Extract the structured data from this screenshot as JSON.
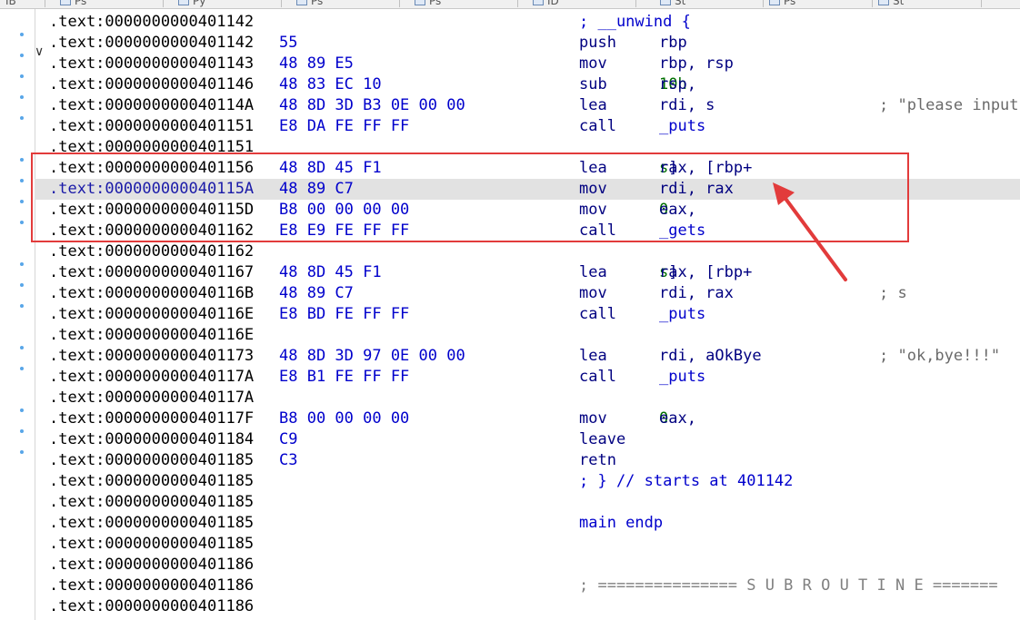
{
  "window": {
    "tabs": [
      "IB",
      "Ps",
      "Py",
      "Ps",
      "Ps",
      "ID",
      "St",
      "Ps",
      "St"
    ]
  },
  "listing": [
    {
      "addr": ".text:0000000000401142",
      "bytes": "",
      "mnem": "; __unwind {",
      "ops": [],
      "cmt": ""
    },
    {
      "addr": ".text:0000000000401142",
      "bytes": "55",
      "mnem": "push",
      "ops": [
        {
          "t": "rbp",
          "c": "reg"
        }
      ],
      "cmt": ""
    },
    {
      "addr": ".text:0000000000401143",
      "bytes": "48 89 E5",
      "mnem": "mov",
      "ops": [
        {
          "t": "rbp, rsp",
          "c": "reg"
        }
      ],
      "cmt": ""
    },
    {
      "addr": ".text:0000000000401146",
      "bytes": "48 83 EC 10",
      "mnem": "sub",
      "ops": [
        {
          "t": "rsp, ",
          "c": "reg"
        },
        {
          "t": "10h",
          "c": "num"
        }
      ],
      "cmt": ""
    },
    {
      "addr": ".text:000000000040114A",
      "bytes": "48 8D 3D B3 0E 00 00",
      "mnem": "lea",
      "ops": [
        {
          "t": "rdi, s",
          "c": "reg"
        }
      ],
      "cmt": "; \"please input"
    },
    {
      "addr": ".text:0000000000401151",
      "bytes": "E8 DA FE FF FF",
      "mnem": "call",
      "ops": [
        {
          "t": "_puts",
          "c": "func"
        }
      ],
      "cmt": ""
    },
    {
      "addr": ".text:0000000000401151",
      "bytes": "",
      "mnem": "",
      "ops": [],
      "cmt": ""
    },
    {
      "addr": ".text:0000000000401156",
      "bytes": "48 8D 45 F1",
      "mnem": "lea",
      "ops": [
        {
          "t": "rax, [rbp+",
          "c": "reg"
        },
        {
          "t": "s",
          "c": "sym"
        },
        {
          "t": "]",
          "c": "reg"
        }
      ],
      "cmt": ""
    },
    {
      "addr": ".text:000000000040115A",
      "bytes": "48 89 C7",
      "mnem": "mov",
      "ops": [
        {
          "t": "rdi, rax",
          "c": "reg"
        }
      ],
      "cmt": "",
      "selected": true
    },
    {
      "addr": ".text:000000000040115D",
      "bytes": "B8 00 00 00 00",
      "mnem": "mov",
      "ops": [
        {
          "t": "eax, ",
          "c": "reg"
        },
        {
          "t": "0",
          "c": "num"
        }
      ],
      "cmt": ""
    },
    {
      "addr": ".text:0000000000401162",
      "bytes": "E8 E9 FE FF FF",
      "mnem": "call",
      "ops": [
        {
          "t": "_gets",
          "c": "func"
        }
      ],
      "cmt": ""
    },
    {
      "addr": ".text:0000000000401162",
      "bytes": "",
      "mnem": "",
      "ops": [],
      "cmt": ""
    },
    {
      "addr": ".text:0000000000401167",
      "bytes": "48 8D 45 F1",
      "mnem": "lea",
      "ops": [
        {
          "t": "rax, [rbp+",
          "c": "reg"
        },
        {
          "t": "s",
          "c": "sym"
        },
        {
          "t": "]",
          "c": "reg"
        }
      ],
      "cmt": ""
    },
    {
      "addr": ".text:000000000040116B",
      "bytes": "48 89 C7",
      "mnem": "mov",
      "ops": [
        {
          "t": "rdi, rax",
          "c": "reg"
        }
      ],
      "cmt": "; s"
    },
    {
      "addr": ".text:000000000040116E",
      "bytes": "E8 BD FE FF FF",
      "mnem": "call",
      "ops": [
        {
          "t": "_puts",
          "c": "func"
        }
      ],
      "cmt": ""
    },
    {
      "addr": ".text:000000000040116E",
      "bytes": "",
      "mnem": "",
      "ops": [],
      "cmt": ""
    },
    {
      "addr": ".text:0000000000401173",
      "bytes": "48 8D 3D 97 0E 00 00",
      "mnem": "lea",
      "ops": [
        {
          "t": "rdi, aOkBye",
          "c": "reg"
        }
      ],
      "cmt": "; \"ok,bye!!!\""
    },
    {
      "addr": ".text:000000000040117A",
      "bytes": "E8 B1 FE FF FF",
      "mnem": "call",
      "ops": [
        {
          "t": "_puts",
          "c": "func"
        }
      ],
      "cmt": ""
    },
    {
      "addr": ".text:000000000040117A",
      "bytes": "",
      "mnem": "",
      "ops": [],
      "cmt": ""
    },
    {
      "addr": ".text:000000000040117F",
      "bytes": "B8 00 00 00 00",
      "mnem": "mov",
      "ops": [
        {
          "t": "eax, ",
          "c": "reg"
        },
        {
          "t": "0",
          "c": "num"
        }
      ],
      "cmt": ""
    },
    {
      "addr": ".text:0000000000401184",
      "bytes": "C9",
      "mnem": "leave",
      "ops": [],
      "cmt": ""
    },
    {
      "addr": ".text:0000000000401185",
      "bytes": "C3",
      "mnem": "retn",
      "ops": [],
      "cmt": ""
    },
    {
      "addr": ".text:0000000000401185",
      "bytes": "",
      "mnem": "; } // starts at 401142",
      "ops": [],
      "cmt": ""
    },
    {
      "addr": ".text:0000000000401185",
      "bytes": "",
      "mnem": "",
      "ops": [],
      "cmt": ""
    },
    {
      "addr": ".text:0000000000401185",
      "bytes": "",
      "mnem": "main endp",
      "ops": [],
      "cmt": ""
    },
    {
      "addr": ".text:0000000000401185",
      "bytes": "",
      "mnem": "",
      "ops": [],
      "cmt": ""
    },
    {
      "addr": ".text:0000000000401186",
      "bytes": "",
      "mnem": "",
      "ops": [],
      "cmt": ""
    },
    {
      "addr": ".text:0000000000401186",
      "bytes": "",
      "mnem": "; =============== S U B R O U T I N E =======",
      "ops": [],
      "cmt": ""
    },
    {
      "addr": ".text:0000000000401186",
      "bytes": "",
      "mnem": "",
      "ops": [],
      "cmt": ""
    }
  ],
  "gutter": {
    "dot_color": "#58a6e8",
    "dot_rows": [
      1,
      2,
      3,
      4,
      5,
      7,
      8,
      9,
      10,
      12,
      13,
      14,
      16,
      17,
      19,
      20,
      21
    ],
    "collapse_arrow_row": 1,
    "collapse_icon": "chevron-down-icon"
  },
  "annotation": {
    "color": "#e23b3b",
    "box_rows": [
      7,
      10
    ],
    "arrow_target_row": 7
  }
}
